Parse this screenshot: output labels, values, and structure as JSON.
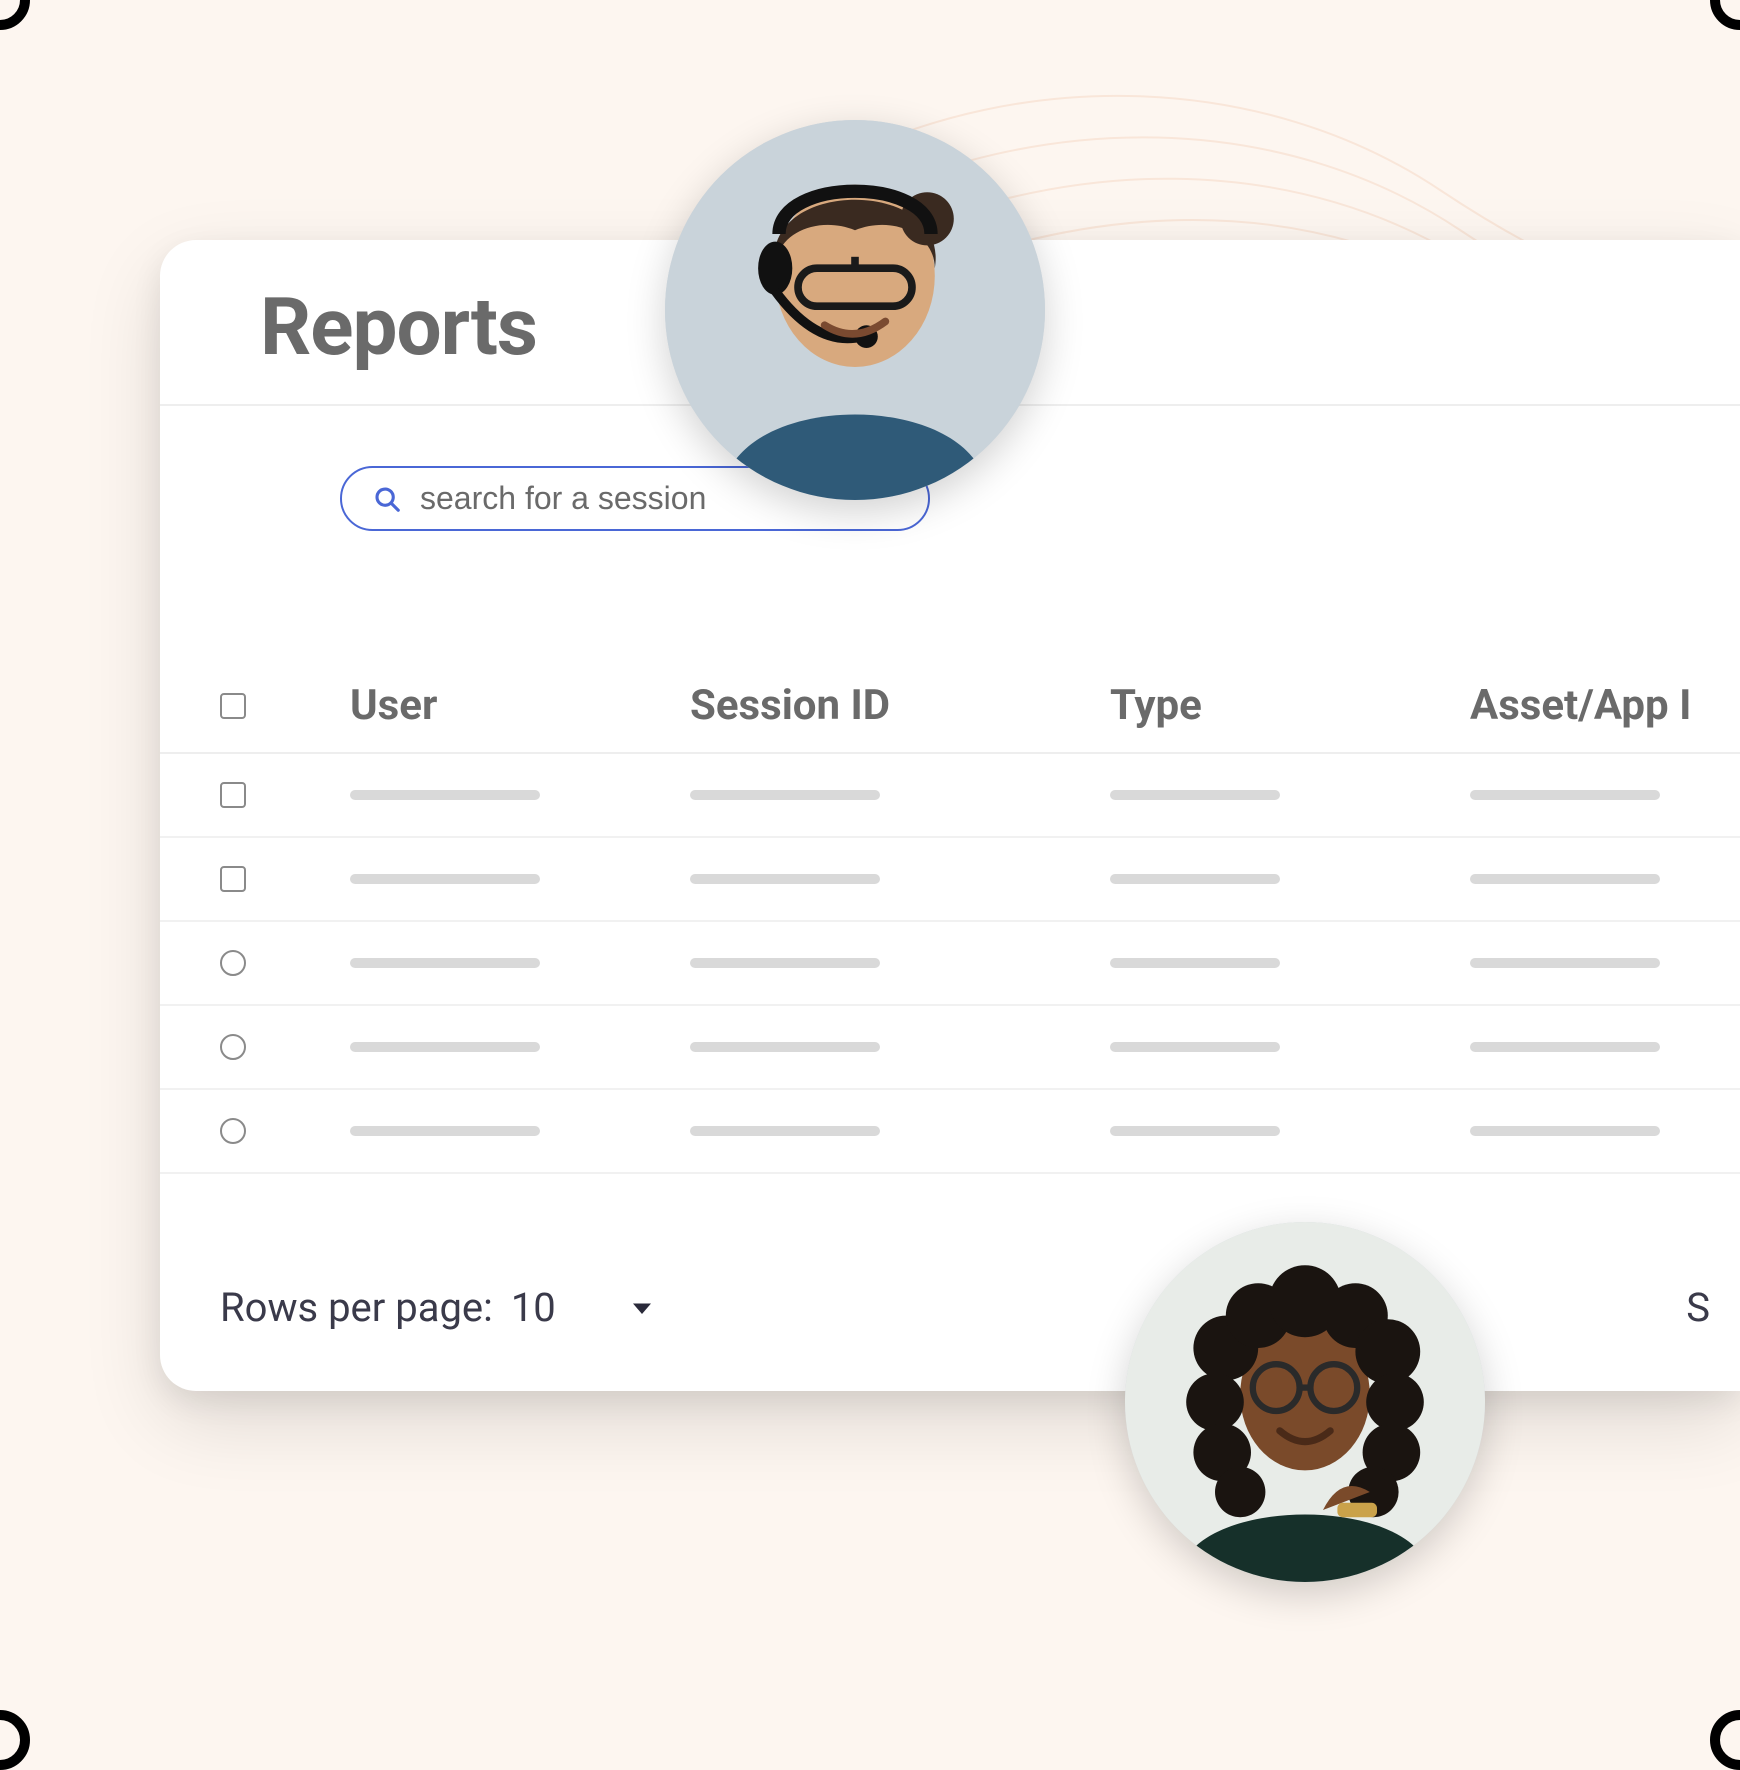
{
  "header": {
    "title": "Reports"
  },
  "search": {
    "placeholder": "search for a session",
    "icon": "search-icon"
  },
  "table": {
    "columns": {
      "user": "User",
      "session_id": "Session ID",
      "type": "Type",
      "asset": "Asset/App I"
    },
    "rows": [
      {
        "selector": "checkbox"
      },
      {
        "selector": "checkbox"
      },
      {
        "selector": "radio"
      },
      {
        "selector": "radio"
      },
      {
        "selector": "radio"
      }
    ]
  },
  "pager": {
    "rows_label": "Rows per page:",
    "rows_value": "10",
    "right_hint": "S"
  },
  "avatars": {
    "top_alt": "support-agent-headset",
    "bottom_alt": "smiling-user-glasses"
  }
}
